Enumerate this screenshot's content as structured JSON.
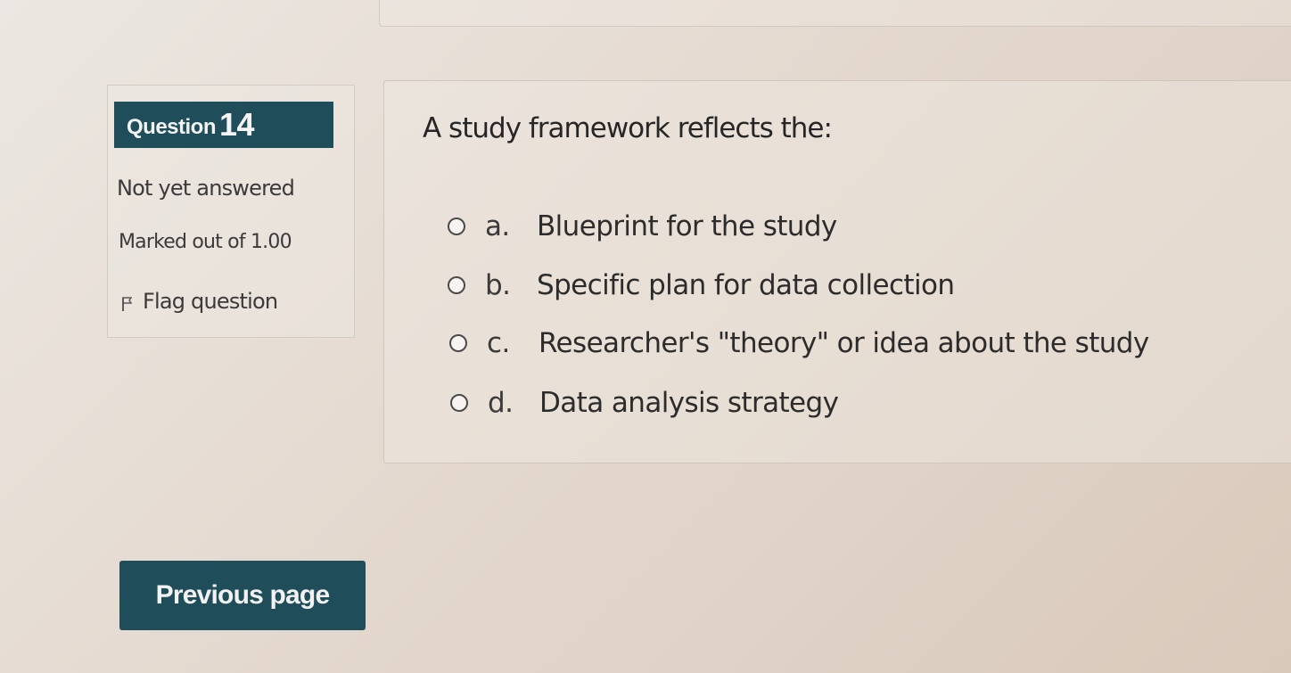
{
  "question_info": {
    "label": "Question",
    "number": "14",
    "state": "Not yet answered",
    "grade": "Marked out of 1.00",
    "flag_label": "Flag question",
    "flag_icon": "flag-icon"
  },
  "question": {
    "text": "A study framework reflects the:",
    "options": [
      {
        "letter": "a.",
        "text": "Blueprint for the study",
        "selected": false
      },
      {
        "letter": "b.",
        "text": "Specific plan for data collection",
        "selected": false
      },
      {
        "letter": "c.",
        "text": "Researcher's \"theory\" or idea about the study",
        "selected": false
      },
      {
        "letter": "d.",
        "text": "Data analysis strategy",
        "selected": false
      }
    ]
  },
  "navigation": {
    "previous_label": "Previous page"
  },
  "colors": {
    "accent": "#1f4d5a",
    "background": "#e4d9cf"
  }
}
